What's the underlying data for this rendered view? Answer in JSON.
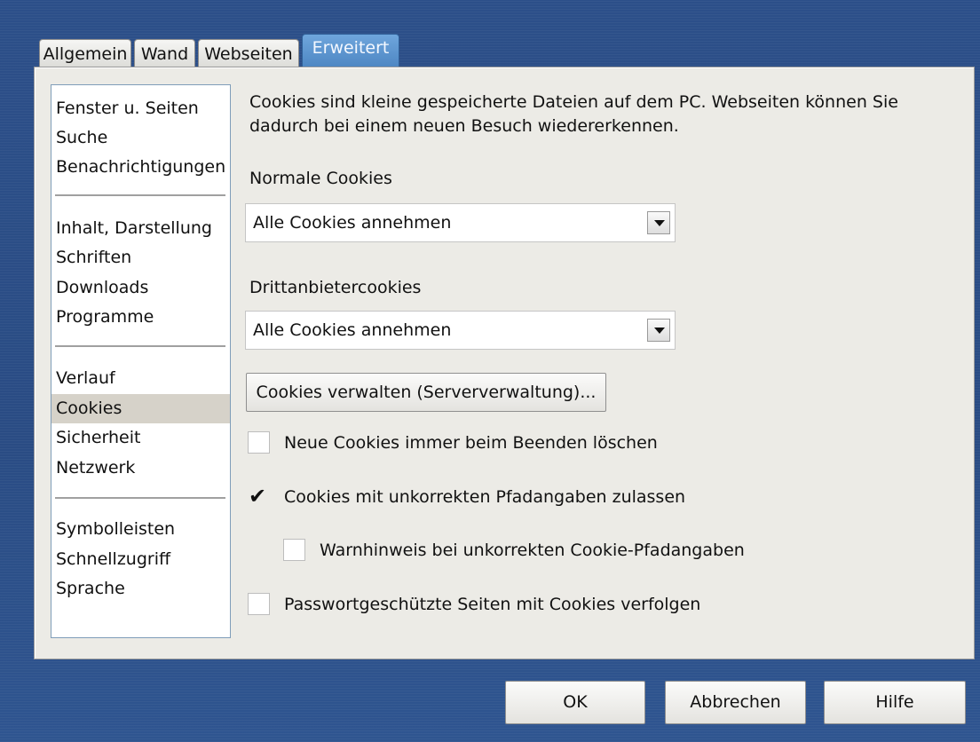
{
  "tabs": [
    "Allgemein",
    "Wand",
    "Webseiten",
    "Erweitert"
  ],
  "active_tab": "Erweitert",
  "sidebar": {
    "groups": [
      [
        "Fenster u. Seiten",
        "Suche",
        "Benachrichtigungen"
      ],
      [
        "Inhalt, Darstellung",
        "Schriften",
        "Downloads",
        "Programme"
      ],
      [
        "Verlauf",
        "Cookies",
        "Sicherheit",
        "Netzwerk"
      ],
      [
        "Symbolleisten",
        "Schnellzugriff",
        "Sprache"
      ]
    ],
    "selected": "Cookies"
  },
  "main": {
    "description_line1": "Cookies sind kleine gespeicherte Dateien auf dem PC. Webseiten können Sie",
    "description_line2": "dadurch bei einem neuen Besuch wiedererkennen.",
    "normal_cookies_label": "Normale Cookies",
    "normal_cookies_value": "Alle Cookies annehmen",
    "third_party_label": "Drittanbietercookies",
    "third_party_value": "Alle Cookies annehmen",
    "manage_button": "Cookies verwalten (Serververwaltung)...",
    "checkboxes": [
      {
        "label": "Neue Cookies immer beim Beenden löschen",
        "checked": false
      },
      {
        "label": "Cookies mit unkorrekten Pfadangaben zulassen",
        "checked": true
      },
      {
        "label": "Warnhinweis bei unkorrekten Cookie-Pfadangaben",
        "checked": false
      },
      {
        "label": "Passwortgeschützte Seiten mit Cookies verfolgen",
        "checked": false
      }
    ]
  },
  "footer": {
    "ok": "OK",
    "cancel": "Abbrechen",
    "help": "Hilfe"
  }
}
